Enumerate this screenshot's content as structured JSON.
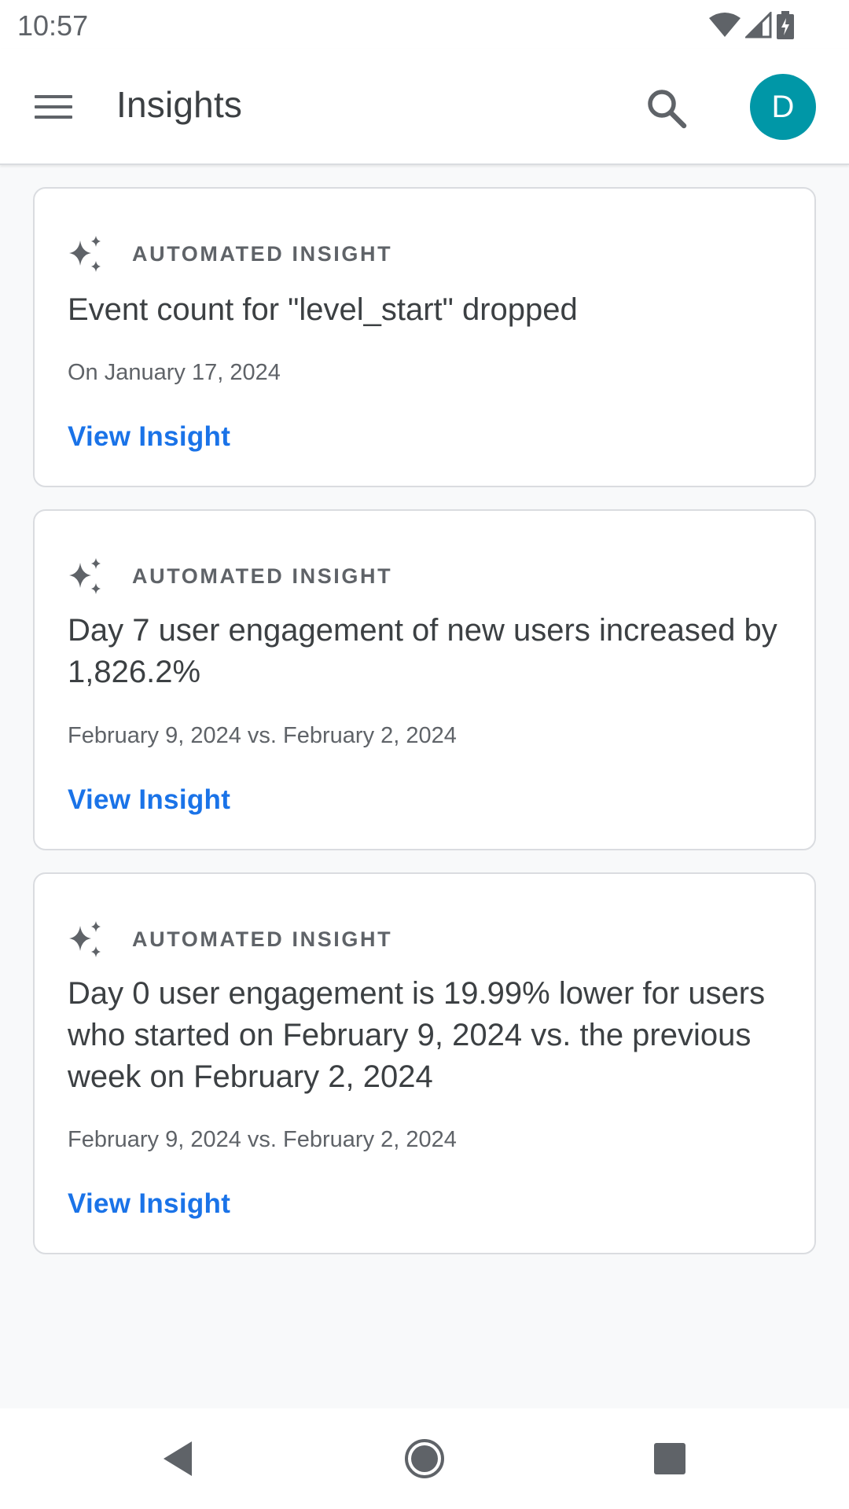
{
  "status_bar": {
    "time": "10:57"
  },
  "app_bar": {
    "title": "Insights",
    "avatar_letter": "D"
  },
  "cards": [
    {
      "kicker": "AUTOMATED INSIGHT",
      "title": "Event count for \"level_start\" dropped",
      "date": "On January 17, 2024",
      "link": "View Insight"
    },
    {
      "kicker": "AUTOMATED INSIGHT",
      "title": "Day 7 user engagement of new users increased by 1,826.2%",
      "date": "February 9, 2024 vs. February 2, 2024",
      "link": "View Insight"
    },
    {
      "kicker": "AUTOMATED INSIGHT",
      "title": "Day 0 user engagement is 19.99% lower for users who started on February 9, 2024 vs. the previous week on February 2, 2024",
      "date": "February 9, 2024 vs. February 2, 2024",
      "link": "View Insight"
    }
  ],
  "icons": {
    "menu": "menu-icon",
    "search": "search-icon",
    "sparkle": "sparkle-icon",
    "wifi": "wifi-icon",
    "signal": "signal-icon",
    "battery": "battery-icon",
    "back": "back-icon",
    "home": "home-icon",
    "recents": "recents-icon"
  },
  "colors": {
    "accent": "#1a73e8",
    "avatar": "#0097a7",
    "background": "#f8f9fa"
  }
}
